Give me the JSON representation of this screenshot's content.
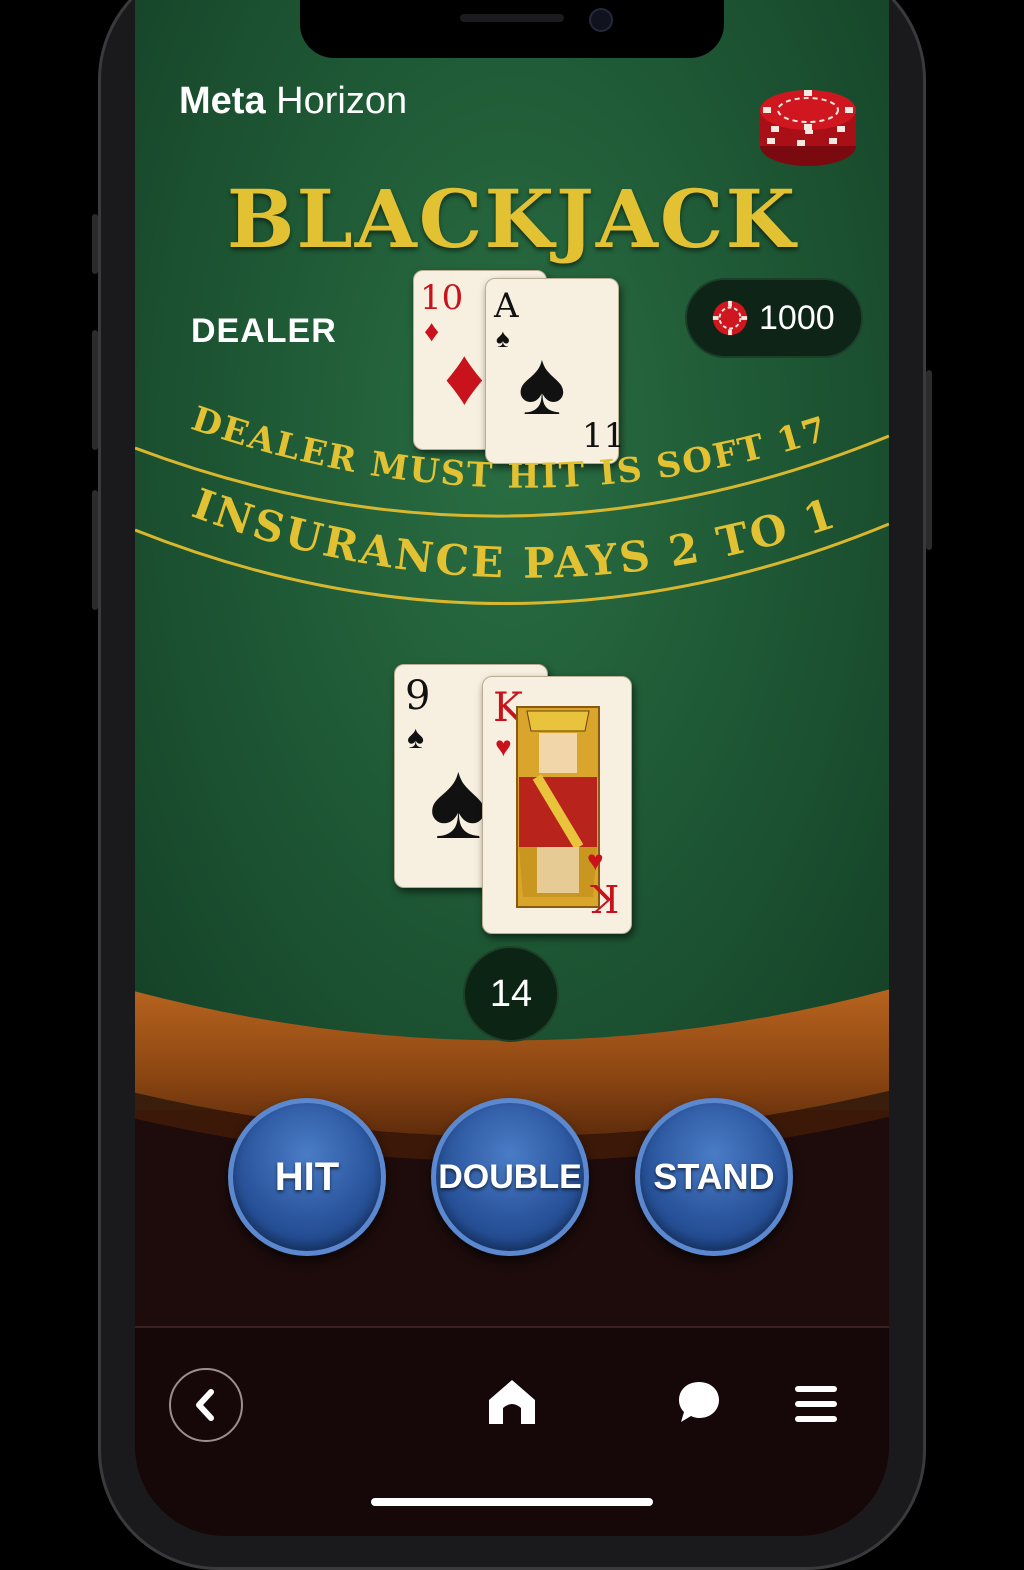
{
  "app": {
    "brand_first": "Meta",
    "brand_second": "Horizon"
  },
  "table": {
    "title": "BLACKJACK",
    "dealer_label": "DEALER",
    "rule_line_1": "DEALER MUST HIT IS SOFT 17",
    "rule_line_2": "INSURANCE PAYS 2 TO 1"
  },
  "balance": {
    "value": "1000",
    "icon": "chip-icon"
  },
  "dealer_hand": {
    "cards": [
      {
        "rank": "10",
        "suit": "♦",
        "color": "red"
      },
      {
        "rank": "A",
        "suit": "♠",
        "color": "black",
        "corner_value": "11"
      }
    ]
  },
  "player_hand": {
    "cards": [
      {
        "rank": "9",
        "suit": "♠",
        "color": "black"
      },
      {
        "rank": "K",
        "suit": "♥",
        "color": "red"
      }
    ],
    "total": "14"
  },
  "actions": {
    "hit": "HIT",
    "double": "DOUBLE",
    "stand": "STAND"
  },
  "nav": {
    "back_icon": "chevron-left-icon",
    "home_icon": "home-icon",
    "chat_icon": "chat-bubble-icon",
    "menu_icon": "hamburger-menu-icon"
  },
  "colors": {
    "felt": "#1f5a36",
    "gold": "#e2c233",
    "button": "#2a559d",
    "chip": "#c8131c"
  }
}
